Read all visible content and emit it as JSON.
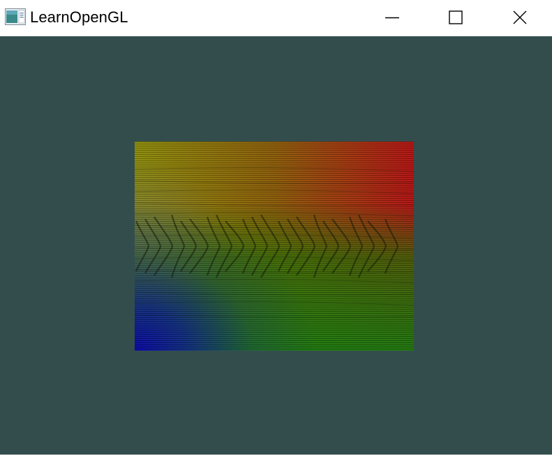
{
  "window": {
    "title": "LearnOpenGL",
    "app_icon": "app-window-icon",
    "controls": {
      "minimize_icon": "minimize-icon",
      "maximize_icon": "maximize-icon",
      "close_icon": "close-icon"
    }
  },
  "colors": {
    "titlebar_background": "#ffffff",
    "clear_color": "#334d4d",
    "quad_corner_top_left": "#8a8a08",
    "quad_corner_top_right": "#b01010",
    "quad_corner_bottom_right": "#1a8a0a",
    "quad_corner_bottom_left": "#0505a0"
  },
  "scene": {
    "object": "textured-quad",
    "texture": "wood-container-texture"
  }
}
